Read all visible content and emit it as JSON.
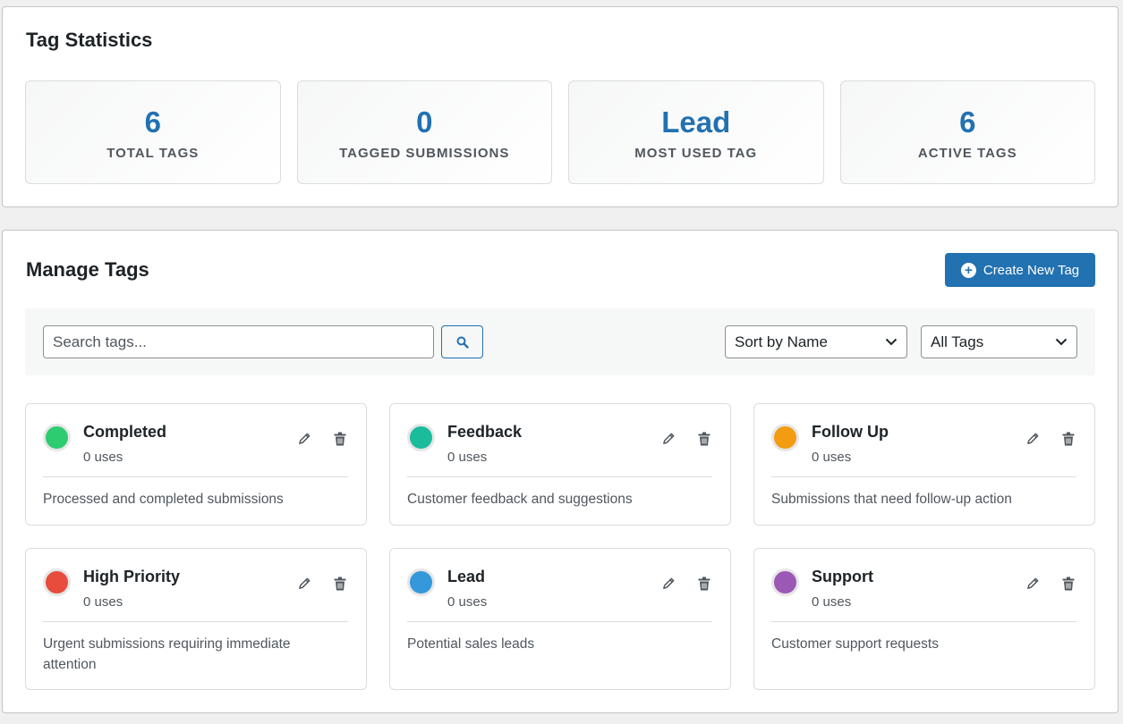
{
  "stats": {
    "title": "Tag Statistics",
    "cards": [
      {
        "value": "6",
        "label": "TOTAL TAGS"
      },
      {
        "value": "0",
        "label": "TAGGED SUBMISSIONS"
      },
      {
        "value": "Lead",
        "label": "MOST USED TAG"
      },
      {
        "value": "6",
        "label": "ACTIVE TAGS"
      }
    ]
  },
  "manage": {
    "title": "Manage Tags",
    "create_button": "Create New Tag",
    "search_placeholder": "Search tags...",
    "sort_selected": "Sort by Name",
    "filter_selected": "All Tags"
  },
  "tags": [
    {
      "name": "Completed",
      "uses": "0 uses",
      "description": "Processed and completed submissions",
      "color": "#2ecc71"
    },
    {
      "name": "Feedback",
      "uses": "0 uses",
      "description": "Customer feedback and suggestions",
      "color": "#1abc9c"
    },
    {
      "name": "Follow Up",
      "uses": "0 uses",
      "description": "Submissions that need follow-up action",
      "color": "#f39c12"
    },
    {
      "name": "High Priority",
      "uses": "0 uses",
      "description": "Urgent submissions requiring immediate attention",
      "color": "#e74c3c"
    },
    {
      "name": "Lead",
      "uses": "0 uses",
      "description": "Potential sales leads",
      "color": "#3498db"
    },
    {
      "name": "Support",
      "uses": "0 uses",
      "description": "Customer support requests",
      "color": "#9b59b6"
    }
  ],
  "colors": {
    "accent": "#2271b1"
  },
  "icons": [
    "plus-circle-icon",
    "search-icon",
    "chevron-down-icon",
    "pencil-icon",
    "trash-icon"
  ]
}
